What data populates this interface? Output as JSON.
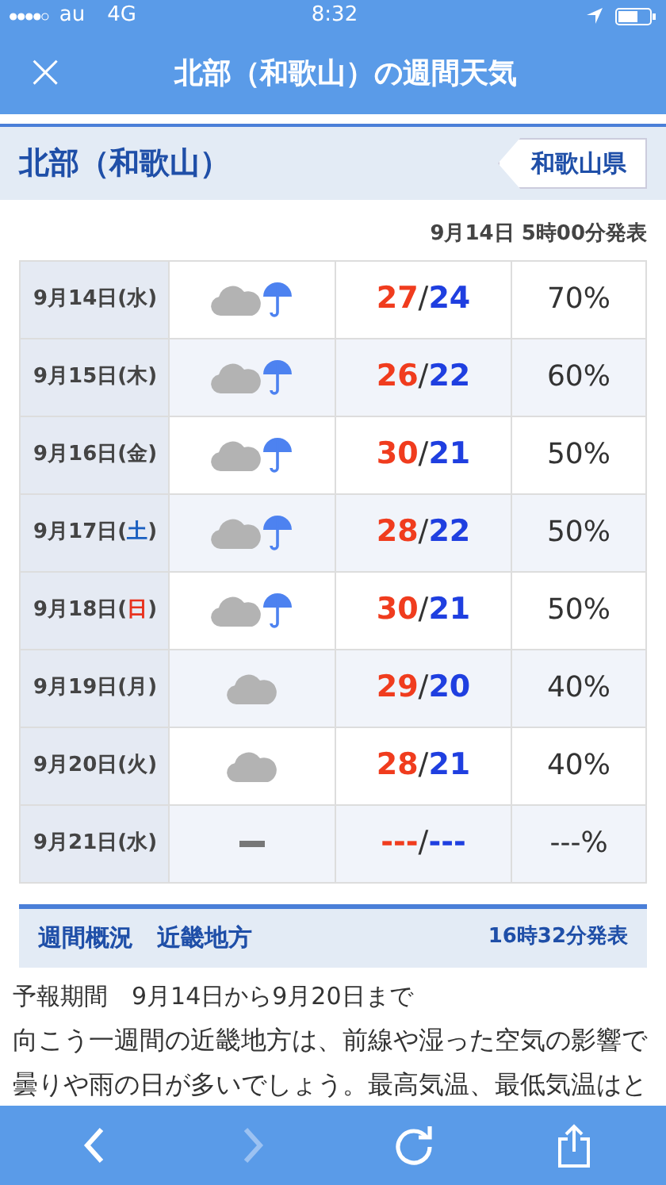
{
  "status_bar": {
    "carrier": "au",
    "network": "4G",
    "time": "8:32"
  },
  "header": {
    "close": "×",
    "title": "北部（和歌山）の週間天気"
  },
  "region": {
    "title": "北部（和歌山）",
    "prefecture_link": "和歌山県"
  },
  "issued": "9月14日 5時00分発表",
  "forecast": [
    {
      "date": "9月14日",
      "open": "(",
      "weekday": "水",
      "close": ")",
      "color": "#444444",
      "kind": "cloud_umbrella",
      "high": "27",
      "low": "24",
      "precip": "70%"
    },
    {
      "date": "9月15日",
      "open": "(",
      "weekday": "木",
      "close": ")",
      "color": "#444444",
      "kind": "cloud_umbrella",
      "high": "26",
      "low": "22",
      "precip": "60%"
    },
    {
      "date": "9月16日",
      "open": "(",
      "weekday": "金",
      "close": ")",
      "color": "#444444",
      "kind": "cloud_umbrella",
      "high": "30",
      "low": "21",
      "precip": "50%"
    },
    {
      "date": "9月17日",
      "open": "(",
      "weekday": "土",
      "close": ")",
      "color": "#1a5fc0",
      "kind": "cloud_umbrella",
      "high": "28",
      "low": "22",
      "precip": "50%"
    },
    {
      "date": "9月18日",
      "open": "(",
      "weekday": "日",
      "close": ")",
      "color": "#e8321e",
      "kind": "cloud_umbrella",
      "high": "30",
      "low": "21",
      "precip": "50%"
    },
    {
      "date": "9月19日",
      "open": "(",
      "weekday": "月",
      "close": ")",
      "color": "#444444",
      "kind": "cloud",
      "high": "29",
      "low": "20",
      "precip": "40%"
    },
    {
      "date": "9月20日",
      "open": "(",
      "weekday": "火",
      "close": ")",
      "color": "#444444",
      "kind": "cloud",
      "high": "28",
      "low": "21",
      "precip": "40%"
    },
    {
      "date": "9月21日",
      "open": "(",
      "weekday": "水",
      "close": ")",
      "color": "#444444",
      "kind": "none",
      "high": "---",
      "low": "---",
      "precip": "---%"
    }
  ],
  "outlook": {
    "title": "週間概況　近畿地方",
    "issued": "16時32分発表",
    "period": "予報期間　9月14日から9月20日まで",
    "body": "向こう一週間の近畿地方は、前線や湿った空気の影響で曇りや雨の日が多いでしょう。最高気温、最低気温はと"
  },
  "separator": "/"
}
